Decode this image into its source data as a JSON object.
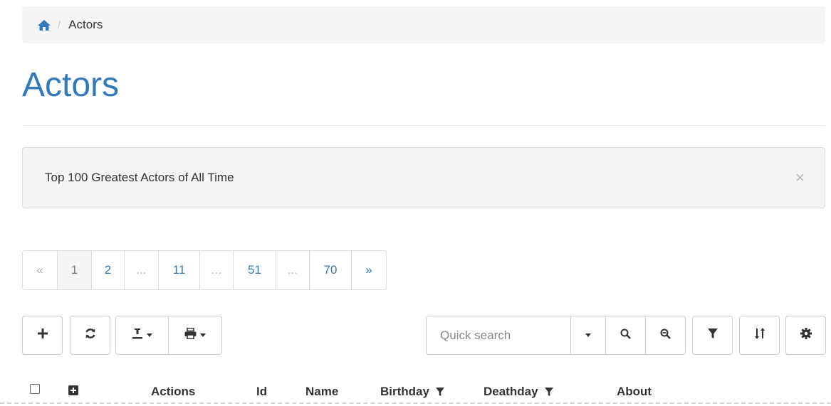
{
  "breadcrumb": {
    "current": "Actors"
  },
  "page": {
    "title": "Actors"
  },
  "alert": {
    "text": "Top 100 Greatest Actors of All Time",
    "close": "×"
  },
  "pagination": {
    "first": "«",
    "pages": [
      "1",
      "2",
      "...",
      "11",
      "...",
      "51",
      "...",
      "70"
    ],
    "active": "1",
    "next": "»"
  },
  "toolbar": {
    "add_icon": "plus-icon",
    "refresh_icon": "refresh-icon",
    "export_icon": "export-icon",
    "print_icon": "print-icon",
    "search": {
      "placeholder": "Quick search",
      "value": ""
    },
    "search_options_icon": "caret-down-icon",
    "search_icon": "search-icon",
    "reset_search_icon": "zoom-out-icon",
    "filter_icon": "filter-icon",
    "sort_icon": "sort-icon",
    "settings_icon": "gear-icon"
  },
  "table": {
    "columns": [
      "Actions",
      "Id",
      "Name",
      "Birthday",
      "Deathday",
      "About"
    ]
  },
  "colors": {
    "accent": "#337ab7",
    "well": "#f5f5f5",
    "border": "#cccccc"
  }
}
